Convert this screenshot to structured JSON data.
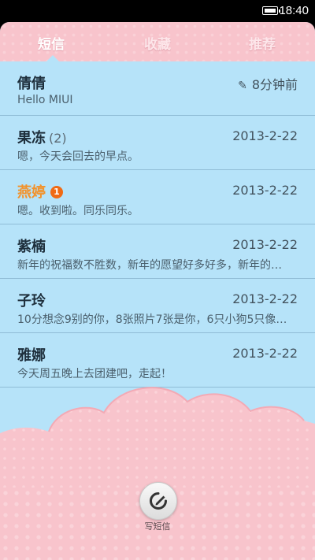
{
  "status_bar": {
    "time": "18:40"
  },
  "tabs": [
    {
      "label": "短信",
      "active": true
    },
    {
      "label": "收藏",
      "active": false
    },
    {
      "label": "推荐",
      "active": false
    }
  ],
  "conversations": [
    {
      "name": "倩倩",
      "count": "",
      "badge": "",
      "time": "8分钟前",
      "draft": true,
      "preview": "Hello MIUI"
    },
    {
      "name": "果冻",
      "count": "(2)",
      "badge": "",
      "time": "2013-2-22",
      "draft": false,
      "preview": "嗯，今天会回去的早点。"
    },
    {
      "name": "燕婷",
      "count": "",
      "badge": "1",
      "time": "2013-2-22",
      "draft": false,
      "preview": "嗯。收到啦。同乐同乐。"
    },
    {
      "name": "紫楠",
      "count": "",
      "badge": "",
      "time": "2013-2-22",
      "draft": false,
      "preview": "新年的祝福数不胜数，新年的愿望好多好多，新年的…"
    },
    {
      "name": "子玲",
      "count": "",
      "badge": "",
      "time": "2013-2-22",
      "draft": false,
      "preview": "10分想念9别的你，8张照片7张是你，6只小狗5只像…"
    },
    {
      "name": "雅娜",
      "count": "",
      "badge": "",
      "time": "2013-2-22",
      "draft": false,
      "preview": "今天周五晚上去团建吧，走起！"
    }
  ],
  "compose": {
    "label": "写短信",
    "icon": "compose-pencil-icon"
  },
  "colors": {
    "tab_pink": "#f8c4cc",
    "list_blue": "#b6e3f9",
    "badge_orange": "#f06a14",
    "highlight_name": "#f2922b"
  }
}
